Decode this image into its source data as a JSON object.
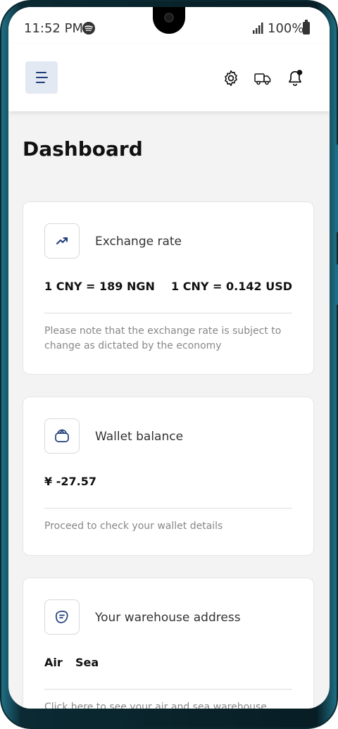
{
  "status_bar": {
    "time": "11:52 PM",
    "battery": "100%"
  },
  "icons": {
    "menu": "menu-icon",
    "settings": "gear-icon",
    "shipping": "truck-icon",
    "notifications": "bell-icon"
  },
  "page": {
    "title": "Dashboard"
  },
  "cards": {
    "exchange": {
      "title": "Exchange rate",
      "rate_ngn": "1 CNY = 189 NGN",
      "rate_usd": "1 CNY = 0.142 USD",
      "note": "Please note that the exchange rate is subject to change as dictated by the economy"
    },
    "wallet": {
      "title": "Wallet balance",
      "balance": "¥ -27.57",
      "note": "Proceed to check your wallet details"
    },
    "warehouse": {
      "title": "Your warehouse address",
      "option_air": "Air",
      "option_sea": "Sea",
      "note": "Click here to see your air and sea warehouse"
    }
  },
  "colors": {
    "accent": "#1f3d7a",
    "menu_bg": "#e3e9f3",
    "page_bg": "#f3f3f3"
  }
}
